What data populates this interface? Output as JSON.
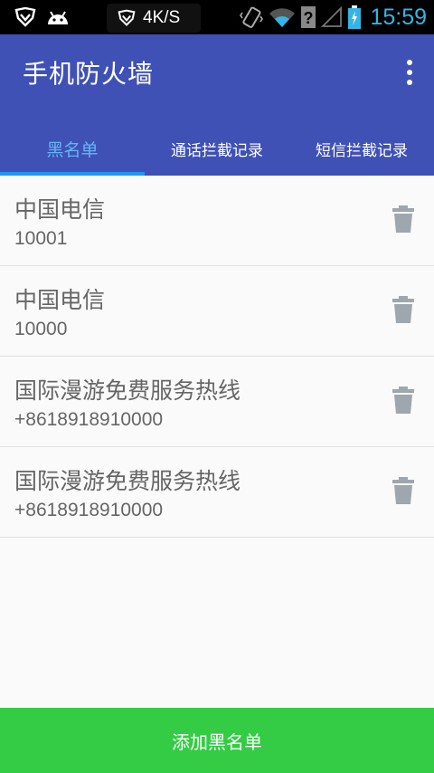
{
  "status_bar": {
    "net_speed": "4K/S",
    "time": "15:59",
    "icons": [
      "shield-icon",
      "android-icon",
      "shield-icon",
      "vibrate-icon",
      "wifi-icon",
      "signal-icon",
      "battery-icon"
    ]
  },
  "app_bar": {
    "title": "手机防火墙",
    "menu_icon": "overflow-menu-icon"
  },
  "tabs": [
    {
      "label": "黑名单",
      "active": true
    },
    {
      "label": "通话拦截记录",
      "active": false
    },
    {
      "label": "短信拦截记录",
      "active": false
    }
  ],
  "blacklist": [
    {
      "name": "中国电信",
      "number": "10001"
    },
    {
      "name": "中国电信",
      "number": "10000"
    },
    {
      "name": "国际漫游免费服务热线",
      "number": "+8618918910000"
    },
    {
      "name": "国际漫游免费服务热线",
      "number": "+8618918910000"
    }
  ],
  "add_button": {
    "label": "添加黑名单"
  },
  "colors": {
    "primary": "#3f51b5",
    "tab_active": "#64b5f6",
    "indicator": "#2196f3",
    "add_button": "#33cc44",
    "clock": "#33b5e5"
  }
}
